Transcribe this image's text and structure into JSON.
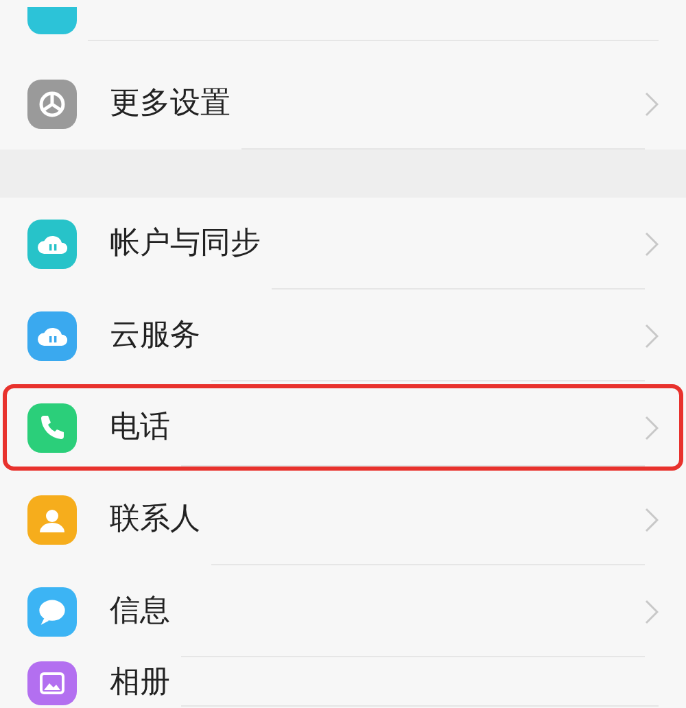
{
  "groups": [
    {
      "items": [
        {
          "kind": "partial",
          "selected": false
        },
        {
          "kind": "gear",
          "label": "更多设置",
          "selected": false
        }
      ]
    },
    {
      "items": [
        {
          "kind": "cloud-sync",
          "label": "帐户与同步",
          "selected": false
        },
        {
          "kind": "cloud",
          "label": "云服务",
          "selected": false
        },
        {
          "kind": "phone",
          "label": "电话",
          "selected": true
        },
        {
          "kind": "contact",
          "label": "联系人",
          "selected": false
        },
        {
          "kind": "message",
          "label": "信息",
          "selected": false
        },
        {
          "kind": "album",
          "label": "相册",
          "selected": false
        }
      ]
    }
  ]
}
